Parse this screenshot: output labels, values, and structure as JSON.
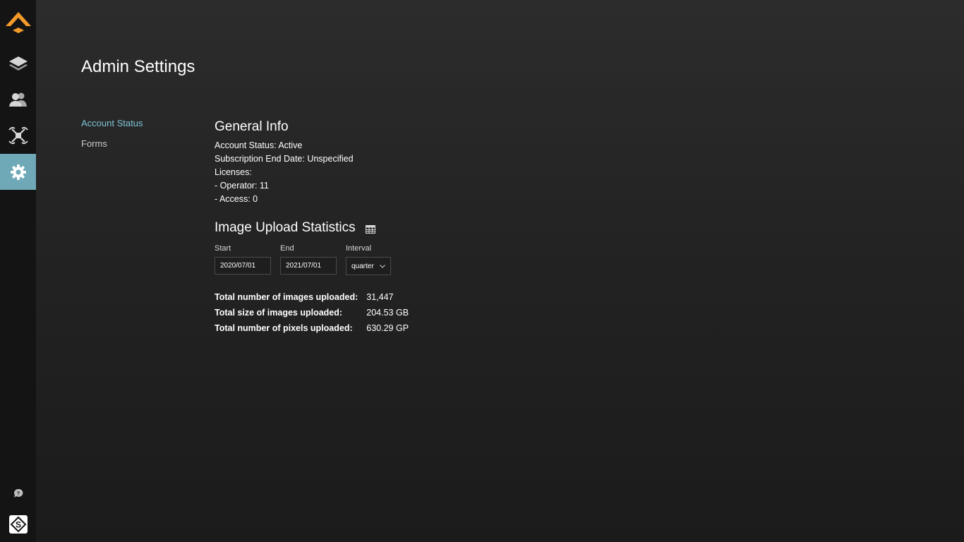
{
  "sidebar": {
    "items": [
      {
        "name": "logo",
        "icon": "chevron-logo-icon"
      },
      {
        "name": "layers",
        "icon": "layers-icon"
      },
      {
        "name": "users",
        "icon": "users-icon"
      },
      {
        "name": "drones",
        "icon": "drone-icon"
      },
      {
        "name": "settings",
        "icon": "gear-icon"
      }
    ],
    "bottom": [
      {
        "name": "help",
        "icon": "chat-help-icon"
      },
      {
        "name": "brand",
        "icon": "brand-logo-icon"
      }
    ],
    "active_color": "#6fa8b6",
    "logo_color": "#f39a2b"
  },
  "page": {
    "title": "Admin Settings"
  },
  "subnav": {
    "account_status": "Account Status",
    "forms": "Forms"
  },
  "general_info": {
    "title": "General Info",
    "account_status": "Account Status: Active",
    "subscription_end": "Subscription End Date: Unspecified",
    "licenses": "Licenses:",
    "operator": "- Operator: 11",
    "access": "- Access: 0"
  },
  "upload_stats": {
    "title": "Image Upload Statistics",
    "start_label": "Start",
    "start_value": "2020/07/01",
    "end_label": "End",
    "end_value": "2021/07/01",
    "interval_label": "Interval",
    "interval_value": "quarter",
    "rows": [
      {
        "label": "Total number of images uploaded:",
        "value": "31,447"
      },
      {
        "label": "Total size of images uploaded:",
        "value": "204.53 GB"
      },
      {
        "label": "Total number of pixels uploaded:",
        "value": "630.29 GP"
      }
    ]
  }
}
